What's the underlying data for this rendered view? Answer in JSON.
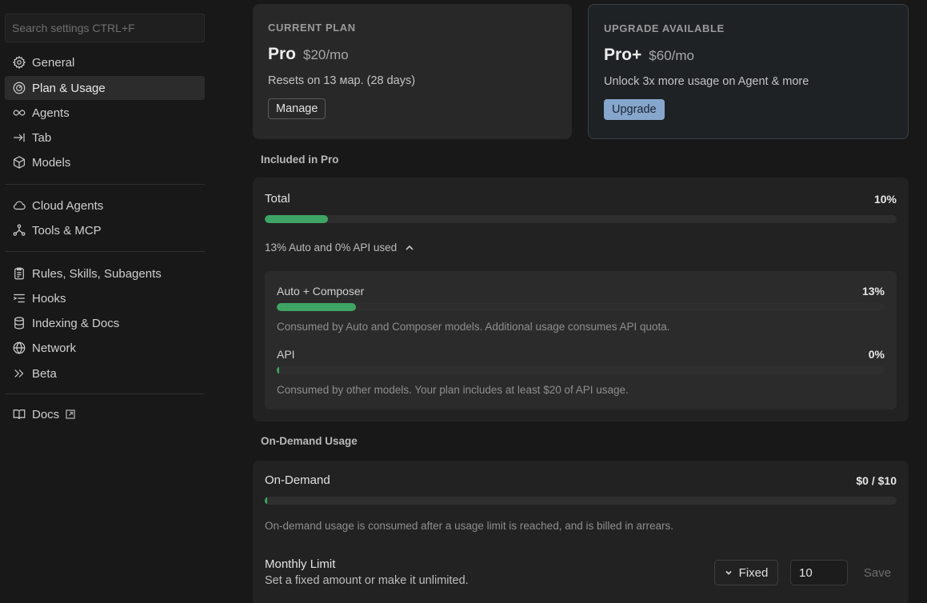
{
  "sidebar": {
    "search_placeholder": "Search settings CTRL+F",
    "items": [
      {
        "label": "General",
        "icon": "gear-icon"
      },
      {
        "label": "Plan & Usage",
        "icon": "gauge-icon",
        "active": true
      },
      {
        "label": "Agents",
        "icon": "infinity-icon"
      },
      {
        "label": "Tab",
        "icon": "tab-arrow-icon"
      },
      {
        "label": "Models",
        "icon": "cube-icon"
      },
      {
        "label": "Cloud Agents",
        "icon": "cloud-icon"
      },
      {
        "label": "Tools & MCP",
        "icon": "network-nodes-icon"
      },
      {
        "label": "Rules, Skills, Subagents",
        "icon": "clipboard-icon"
      },
      {
        "label": "Hooks",
        "icon": "hooks-list-icon"
      },
      {
        "label": "Indexing & Docs",
        "icon": "database-icon"
      },
      {
        "label": "Network",
        "icon": "globe-icon"
      },
      {
        "label": "Beta",
        "icon": "double-chevron-icon"
      },
      {
        "label": "Docs",
        "icon": "book-icon",
        "external": true
      }
    ]
  },
  "current_plan": {
    "eyebrow": "CURRENT PLAN",
    "name": "Pro",
    "price": "$20/mo",
    "desc": "Resets on 13 мар. (28 days)",
    "button": "Manage"
  },
  "upgrade_plan": {
    "eyebrow": "UPGRADE AVAILABLE",
    "name": "Pro+",
    "price": "$60/mo",
    "desc": "Unlock 3x more usage on Agent & more",
    "button": "Upgrade"
  },
  "included": {
    "section_title": "Included in Pro",
    "total": {
      "label": "Total",
      "value": "10%",
      "fraction": 0.1
    },
    "breakdown_toggle": "13% Auto and 0% API used",
    "auto": {
      "label": "Auto + Composer",
      "value": "13%",
      "fraction": 0.13,
      "desc": "Consumed by Auto and Composer models. Additional usage consumes API quota."
    },
    "api": {
      "label": "API",
      "value": "0%",
      "fraction": 0.0,
      "desc": "Consumed by other models. Your plan includes at least $20 of API usage."
    }
  },
  "on_demand": {
    "section_title": "On-Demand Usage",
    "label": "On-Demand",
    "value": "$0 / $10",
    "fraction": 0.0,
    "desc": "On-demand usage is consumed after a usage limit is reached, and is billed in arrears.",
    "monthly_limit_title": "Monthly Limit",
    "monthly_limit_sub": "Set a fixed amount or make it unlimited.",
    "mode": "Fixed",
    "amount": "10",
    "save": "Save"
  },
  "colors": {
    "accent_green": "#3fa564",
    "upgrade_button": "#86a6cc"
  }
}
